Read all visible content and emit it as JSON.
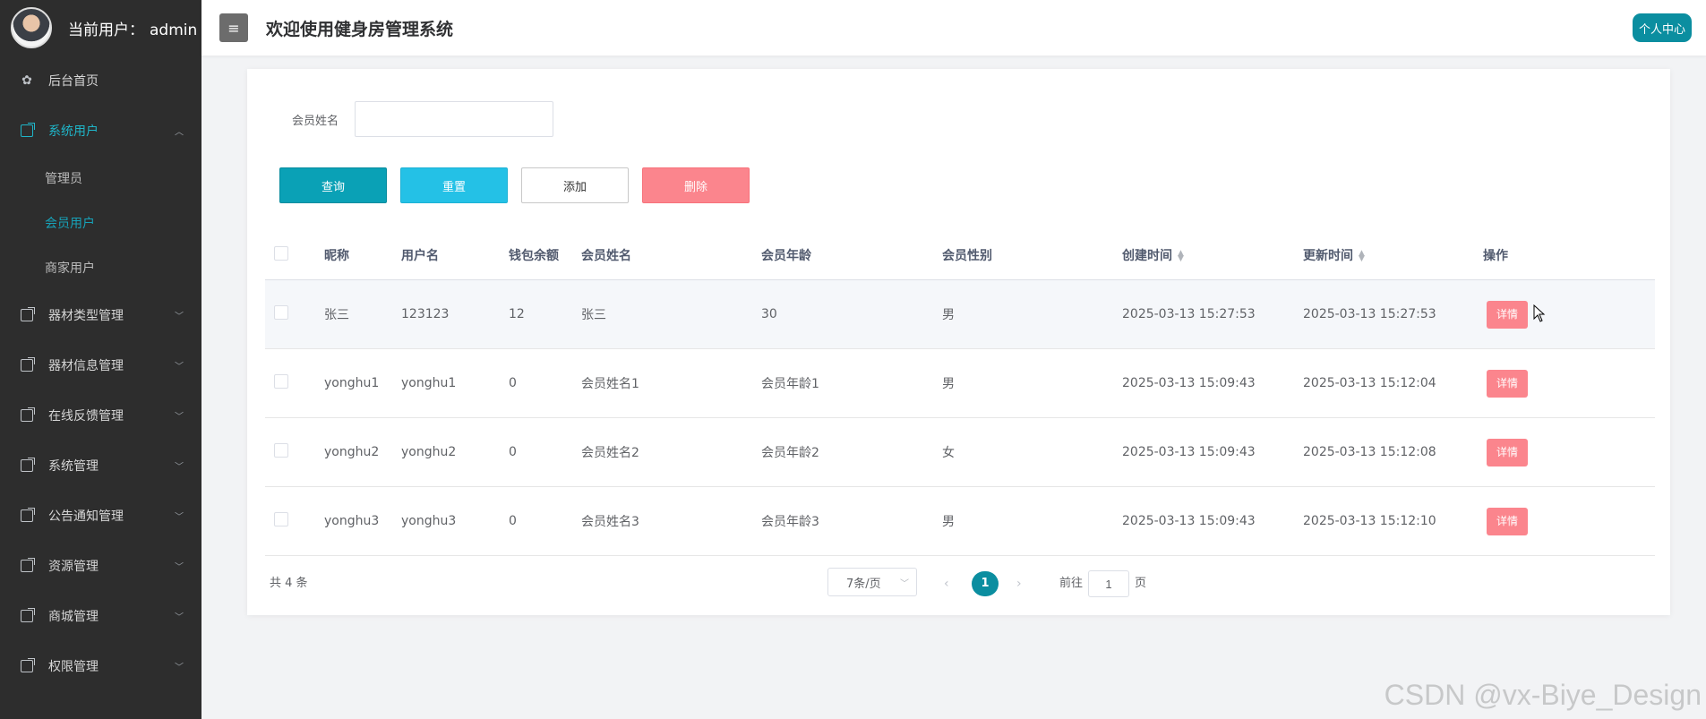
{
  "sidebar": {
    "user_label": "当前用户：",
    "user_name": "admin",
    "home": "后台首页",
    "system_users": "系统用户",
    "sub": [
      "管理员",
      "会员用户",
      "商家用户"
    ],
    "groups": [
      "器材类型管理",
      "器材信息管理",
      "在线反馈管理",
      "系统管理",
      "公告通知管理",
      "资源管理",
      "商城管理",
      "权限管理"
    ]
  },
  "header": {
    "title": "欢迎使用健身房管理系统",
    "profile": "个人中心",
    "menu_icon": "≡"
  },
  "search": {
    "label": "会员姓名",
    "value": ""
  },
  "buttons": {
    "query": "查询",
    "reset": "重置",
    "add": "添加",
    "delete": "删除"
  },
  "table": {
    "headers": [
      "昵称",
      "用户名",
      "钱包余额",
      "会员姓名",
      "会员年龄",
      "会员性别",
      "创建时间",
      "更新时间",
      "操作"
    ],
    "rows": [
      [
        "张三",
        "123123",
        "12",
        "张三",
        "30",
        "男",
        "2025-03-13 15:27:53",
        "2025-03-13 15:27:53",
        "详情"
      ],
      [
        "yonghu1",
        "yonghu1",
        "0",
        "会员姓名1",
        "会员年龄1",
        "男",
        "2025-03-13 15:09:43",
        "2025-03-13 15:12:04",
        "详情"
      ],
      [
        "yonghu2",
        "yonghu2",
        "0",
        "会员姓名2",
        "会员年龄2",
        "女",
        "2025-03-13 15:09:43",
        "2025-03-13 15:12:08",
        "详情"
      ],
      [
        "yonghu3",
        "yonghu3",
        "0",
        "会员姓名3",
        "会员年龄3",
        "男",
        "2025-03-13 15:09:43",
        "2025-03-13 15:12:10",
        "详情"
      ]
    ]
  },
  "pagination": {
    "total": "共 4 条",
    "page_size": "7条/页",
    "current": "1",
    "goto_label": "前往",
    "goto_value": "1",
    "goto_suffix": "页"
  },
  "watermark": "CSDN @vx-Biye_Design",
  "colors": {
    "sidebar_bg": "#2d2d2d",
    "accent": "#0b8ea0",
    "danger": "#fb858d"
  }
}
